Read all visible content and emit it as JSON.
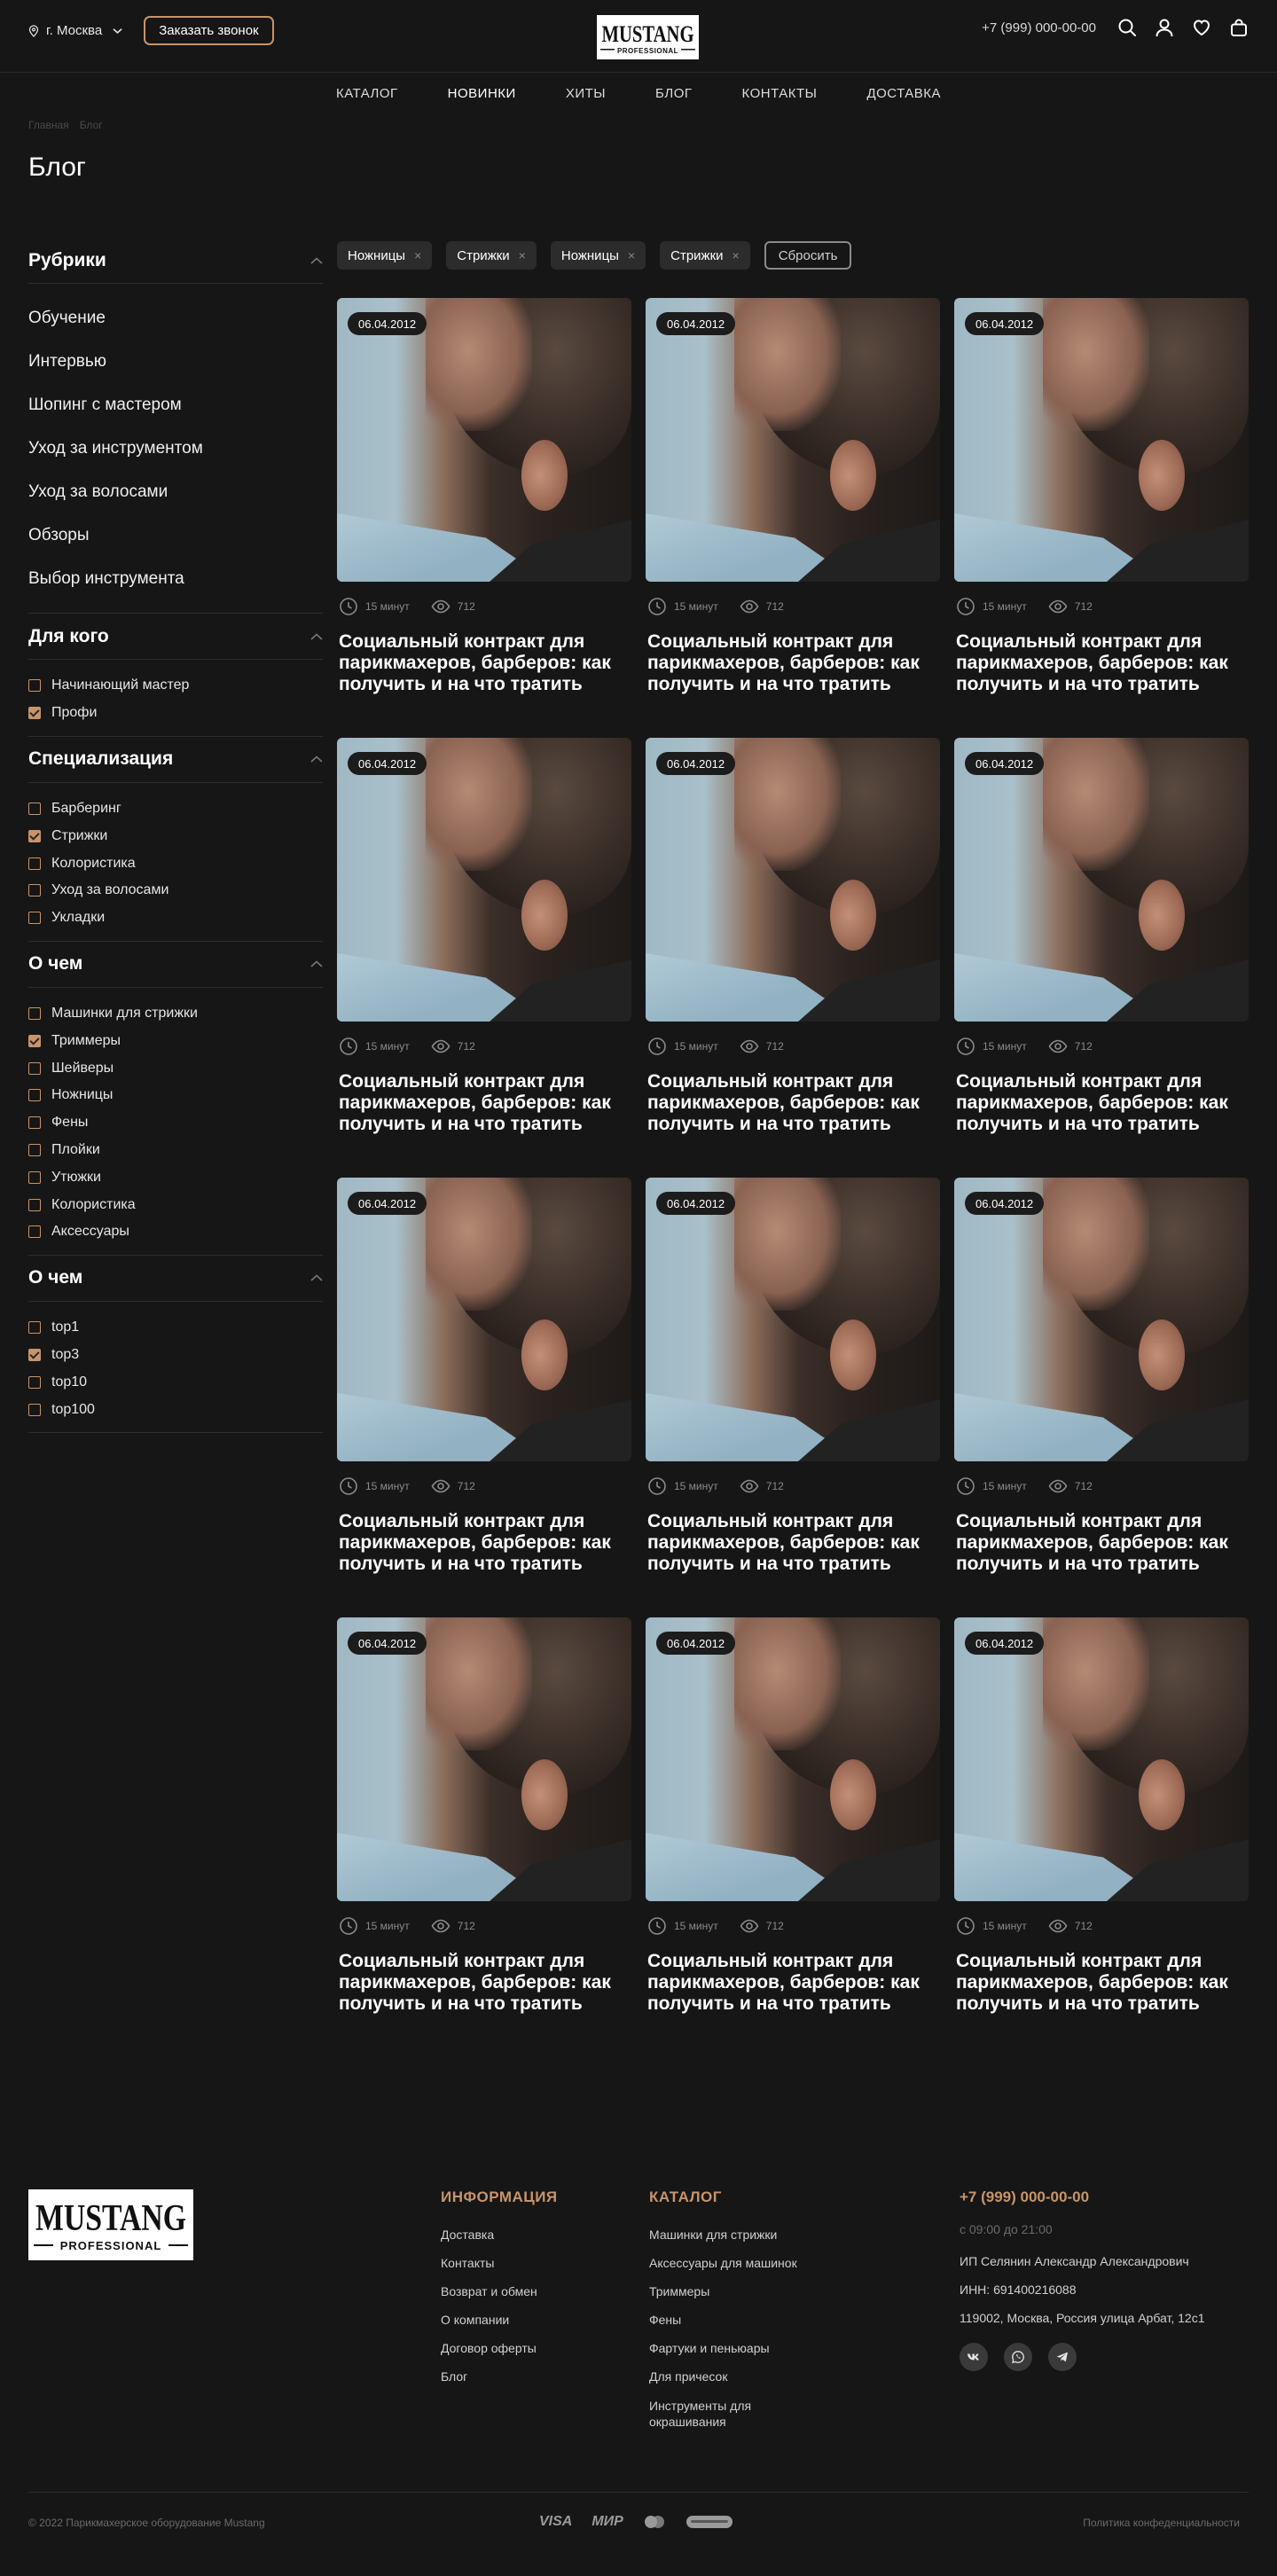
{
  "header": {
    "city": "г. Москва",
    "callback": "Заказать звонок",
    "logo_top": "MUSTANG",
    "logo_bottom": "PROFESSIONAL",
    "phone": "+7 (999) 000-00-00"
  },
  "nav": [
    "КАТАЛОГ",
    "НОВИНКИ",
    "ХИТЫ",
    "БЛОГ",
    "КОНТАКТЫ",
    "ДОСТАВКА"
  ],
  "breadcrumb": [
    "Главная",
    "Блог"
  ],
  "page_title": "Блог",
  "sidebar": {
    "rubrics_title": "Рубрики",
    "rubrics": [
      "Обучение",
      "Интервью",
      "Шопинг с мастером",
      "Уход за инструментом",
      "Уход за волосами",
      "Обзоры",
      "Выбор инструмента"
    ],
    "groups": [
      {
        "title": "Для кого",
        "items": [
          {
            "label": "Начинающий мастер",
            "checked": false
          },
          {
            "label": "Профи",
            "checked": true
          }
        ]
      },
      {
        "title": "Специализация",
        "items": [
          {
            "label": "Барберинг",
            "checked": false
          },
          {
            "label": "Стрижки",
            "checked": true
          },
          {
            "label": "Колористика",
            "checked": false
          },
          {
            "label": "Уход за волосами",
            "checked": false
          },
          {
            "label": "Укладки",
            "checked": false
          }
        ]
      },
      {
        "title": "О чем",
        "items": [
          {
            "label": "Машинки для стрижки",
            "checked": false
          },
          {
            "label": "Триммеры",
            "checked": true
          },
          {
            "label": "Шейверы",
            "checked": false
          },
          {
            "label": "Ножницы",
            "checked": false
          },
          {
            "label": "Фены",
            "checked": false
          },
          {
            "label": "Плойки",
            "checked": false
          },
          {
            "label": "Утюжки",
            "checked": false
          },
          {
            "label": "Колористика",
            "checked": false
          },
          {
            "label": "Аксессуары",
            "checked": false
          }
        ]
      },
      {
        "title": "О чем",
        "items": [
          {
            "label": "top1",
            "checked": false
          },
          {
            "label": "top3",
            "checked": true
          },
          {
            "label": "top10",
            "checked": false
          },
          {
            "label": "top100",
            "checked": false
          }
        ]
      }
    ]
  },
  "filters": {
    "tags": [
      "Ножницы",
      "Стрижки",
      "Ножницы",
      "Стрижки"
    ],
    "remove": "×",
    "reset": "Сбросить"
  },
  "post_template": {
    "date": "06.04.2012",
    "read_time": "15 минут",
    "views": "712",
    "title": "Социальный контракт для парикмахеров, барберов: как получить и на что тратить"
  },
  "posts_count": 12,
  "footer": {
    "info_title": "ИНФОРМАЦИЯ",
    "info_links": [
      "Доставка",
      "Контакты",
      "Возврат и обмен",
      "О компании",
      "Договор оферты",
      "Блог"
    ],
    "catalog_title": "КАТАЛОГ",
    "catalog_links": [
      "Машинки для стрижки",
      "Аксессуары для машинок",
      "Триммеры",
      "Фены",
      "Фартуки и пеньюары",
      "Для причесок",
      "Инструменты для окрашивания"
    ],
    "phone": "+7 (999) 000-00-00",
    "hours": "с 09:00 до 21:00",
    "company": "ИП Селянин Александр Александрович",
    "inn": "ИНН: 691400216088",
    "address": "119002, Москва, Россия улица Арбат, 12с1",
    "copyright": "© 2022 Парикмахерское оборудование Mustang",
    "payments": [
      "VISA",
      "МИР"
    ],
    "privacy": "Политика конфеденциальности"
  },
  "colors": {
    "background": "#161616",
    "accent": "#c8946a",
    "tag_bg": "#2c2c2c"
  }
}
